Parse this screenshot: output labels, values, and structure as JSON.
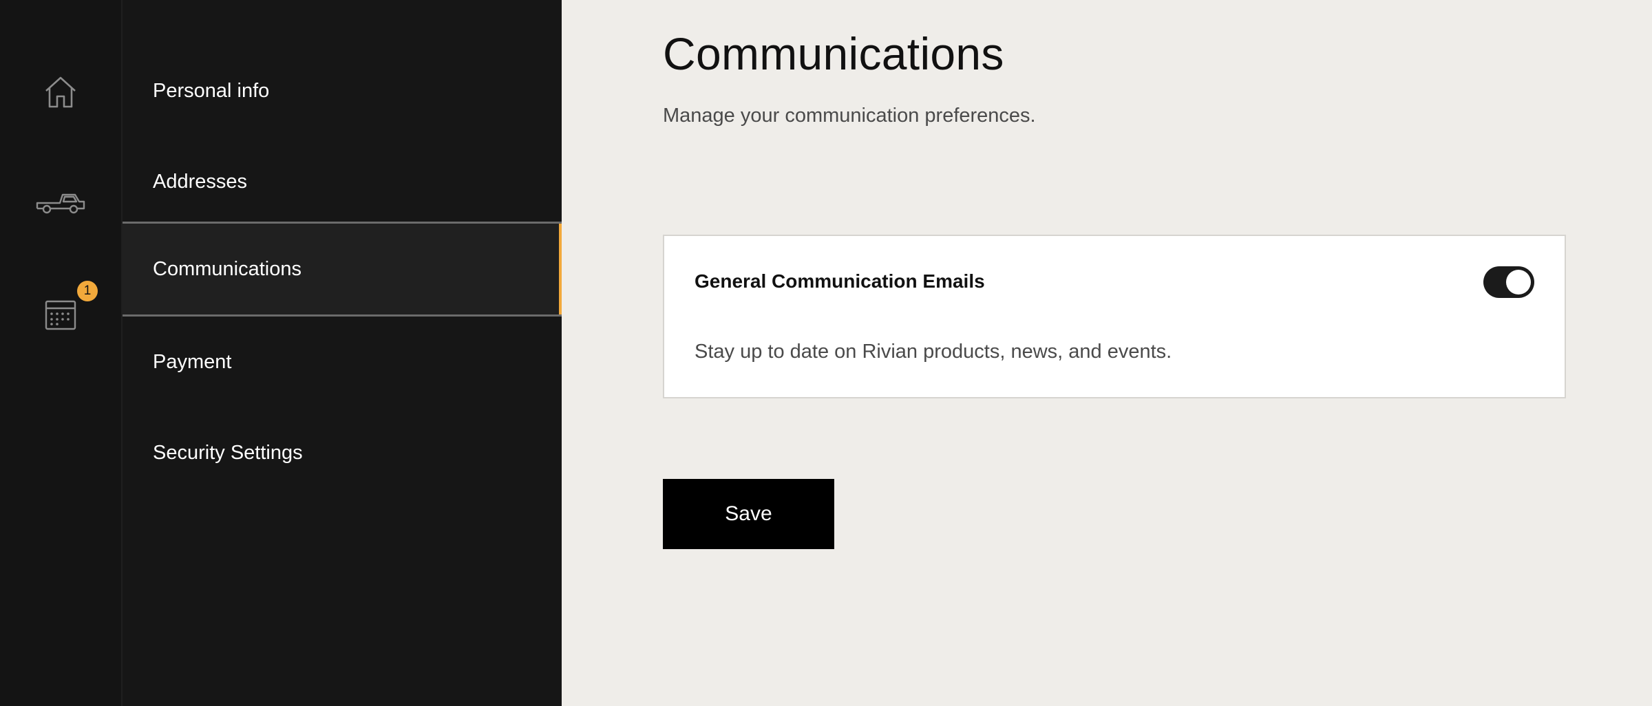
{
  "rail": {
    "items": [
      {
        "icon": "home-icon"
      },
      {
        "icon": "truck-icon"
      },
      {
        "icon": "calendar-icon",
        "badge": "1"
      }
    ],
    "accent_color": "#f2a93b"
  },
  "subnav": {
    "items": [
      {
        "label": "Personal info"
      },
      {
        "label": "Addresses"
      },
      {
        "label": "Communications",
        "active": true
      },
      {
        "label": "Payment"
      },
      {
        "label": "Security Settings"
      }
    ]
  },
  "main": {
    "title": "Communications",
    "subtitle": "Manage your communication preferences.",
    "preferences": [
      {
        "title": "General Communication Emails",
        "description": "Stay up to date on Rivian products, news, and events.",
        "enabled": true
      }
    ],
    "save_label": "Save"
  }
}
